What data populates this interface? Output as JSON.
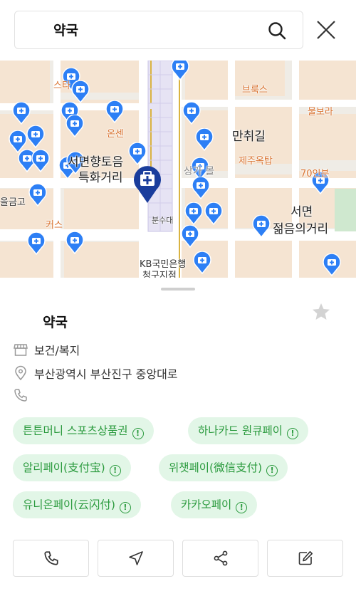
{
  "search": {
    "query": "약국"
  },
  "map": {
    "labels": {
      "seomyeon_hyangto": "서면향토음",
      "teukhwa": "특화거리",
      "manchwigil": "만취길",
      "seomyeon": "서면",
      "jeolmeum": "젊음의거리",
      "bunsudae": "분수대",
      "kb": "KB국민은행",
      "kb2": "청구지점",
      "onsen": "온센",
      "jeju": "제주옥탑",
      "broccoli": "브룩스",
      "mulbora": "물보라",
      "seventy": "70인분",
      "star": "스타",
      "eulgo": "을금고",
      "cuz": "커스",
      "bundong": "분",
      "sangga": "상가 몰"
    },
    "colors": {
      "pin": "#2d7ff5",
      "selected_pin": "#1a3d9c",
      "road": "#ffffff",
      "block": "#f6e2cf"
    }
  },
  "place": {
    "name": "약국",
    "category": "보건/복지",
    "address": "부산광역시 부산진구 중앙대로",
    "phone": ""
  },
  "payments": [
    {
      "label": "튼튼머니 스포츠상품권"
    },
    {
      "label": "하나카드 원큐페이"
    },
    {
      "label": "알리페이(支付宝)"
    },
    {
      "label": "위챗페이(微信支付)"
    },
    {
      "label": "유니온페이(云闪付)"
    },
    {
      "label": "카카오페이"
    }
  ],
  "chip_alert": "!",
  "actions": [
    {
      "icon": "phone-icon"
    },
    {
      "icon": "navigate-icon"
    },
    {
      "icon": "share-icon"
    },
    {
      "icon": "edit-icon"
    }
  ]
}
